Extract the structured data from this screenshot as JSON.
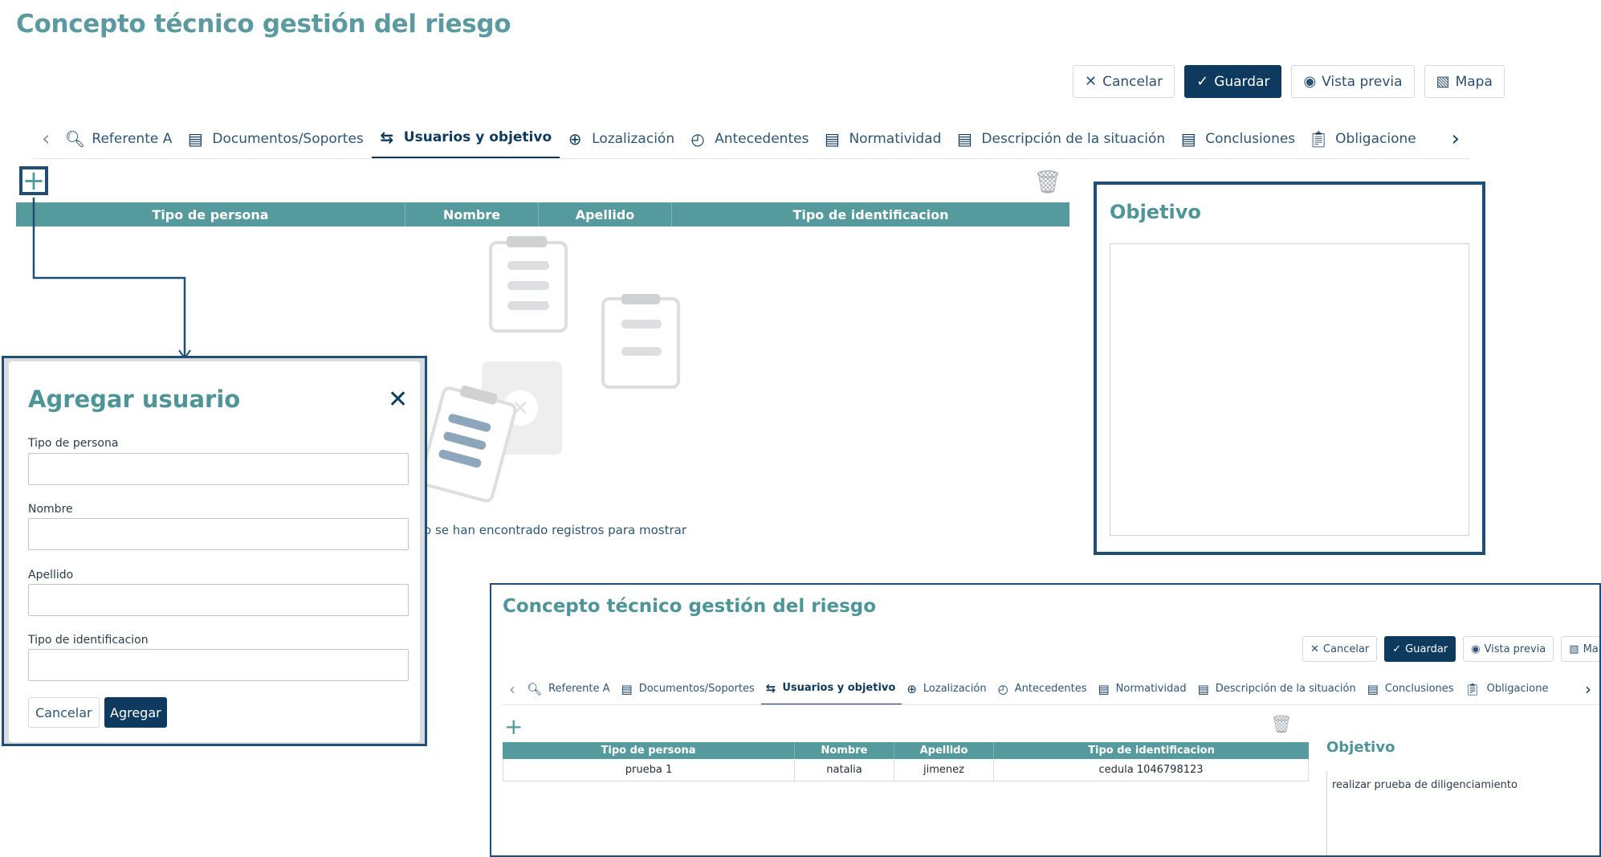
{
  "page": {
    "title": "Concepto técnico gestión del riesgo"
  },
  "toolbar": {
    "cancel": "Cancelar",
    "save": "Guardar",
    "preview": "Vista previa",
    "map": "Mapa"
  },
  "tabs": [
    {
      "label": "Referente A",
      "icon": "search-doc-icon"
    },
    {
      "label": "Documentos/Soportes",
      "icon": "document-icon"
    },
    {
      "label": "Usuarios y objetivo",
      "icon": "swap-icon",
      "active": true
    },
    {
      "label": "Lozalización",
      "icon": "target-icon"
    },
    {
      "label": "Antecedentes",
      "icon": "history-icon"
    },
    {
      "label": "Normatividad",
      "icon": "document-icon"
    },
    {
      "label": "Descripción de la situación",
      "icon": "document-icon"
    },
    {
      "label": "Conclusiones",
      "icon": "document-icon"
    },
    {
      "label": "Obligacione",
      "icon": "clipboard-icon"
    }
  ],
  "grid": {
    "columns": [
      "Tipo de persona",
      "Nombre",
      "Apellido",
      "Tipo de identificacion"
    ],
    "empty_message": "o se han encontrado registros para mostrar"
  },
  "objetivo": {
    "title": "Objetivo",
    "value": ""
  },
  "modal": {
    "title": "Agregar usuario",
    "fields": [
      {
        "label": "Tipo de persona",
        "value": ""
      },
      {
        "label": "Nombre",
        "value": ""
      },
      {
        "label": "Apellido",
        "value": ""
      },
      {
        "label": "Tipo de identificacion",
        "value": ""
      }
    ],
    "cancel": "Cancelar",
    "submit": "Agregar"
  },
  "inset": {
    "title": "Concepto técnico gestión del riesgo",
    "toolbar": {
      "cancel": "Cancelar",
      "save": "Guardar",
      "preview": "Vista previa",
      "map": "Mapa"
    },
    "tabs": [
      {
        "label": "Referente A"
      },
      {
        "label": "Documentos/Soportes"
      },
      {
        "label": "Usuarios y objetivo",
        "active": true
      },
      {
        "label": "Lozalización"
      },
      {
        "label": "Antecedentes"
      },
      {
        "label": "Normatividad"
      },
      {
        "label": "Descripción de la situación"
      },
      {
        "label": "Conclusiones"
      },
      {
        "label": "Obligacione"
      }
    ],
    "grid": {
      "columns": [
        "Tipo de persona",
        "Nombre",
        "Apellido",
        "Tipo de identificacion"
      ],
      "rows": [
        [
          "prueba 1",
          "natalia",
          "jimenez",
          "cedula 1046798123"
        ]
      ]
    },
    "objetivo": {
      "title": "Objetivo",
      "value": "realizar prueba de diligenciamiento"
    }
  }
}
